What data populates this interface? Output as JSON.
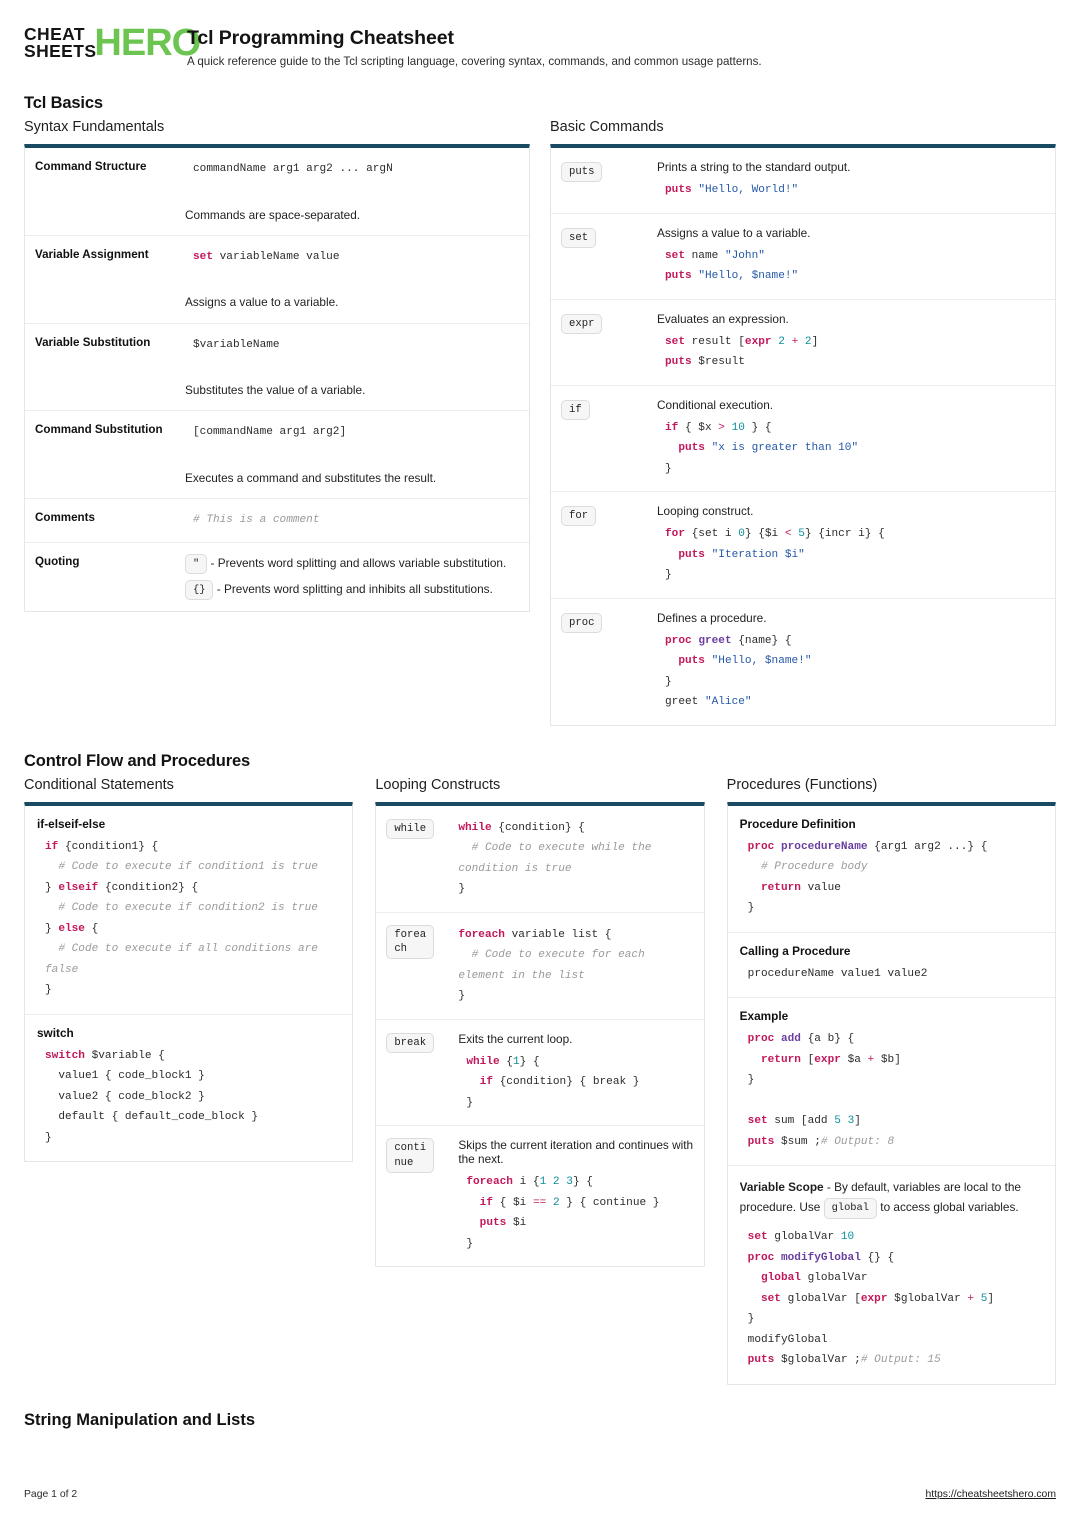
{
  "brand": {
    "line1": "CHEAT",
    "line2": "SHEETS",
    "hero": "HERO",
    "green": "#6cc551"
  },
  "header": {
    "title": "Tcl Programming Cheatsheet",
    "subtitle": "A quick reference guide to the Tcl scripting language, covering syntax, commands, and common usage patterns."
  },
  "sections": {
    "basics": "Tcl Basics",
    "control": "Control Flow and Procedures",
    "strings": "String Manipulation and Lists"
  },
  "syntax": {
    "heading": "Syntax Fundamentals",
    "rows": [
      {
        "label": "Command Structure",
        "code": "commandName arg1 arg2 ... argN",
        "desc": "Commands are space-separated."
      },
      {
        "label": "Variable Assignment",
        "kw": "set",
        "code_rest": " variableName value",
        "desc": "Assigns a value to a variable."
      },
      {
        "label": "Variable Substitution",
        "code": "$variableName",
        "desc": "Substitutes the value of a variable."
      },
      {
        "label": "Command Substitution",
        "code": "[commandName arg1 arg2]",
        "desc": "Executes a command and substitutes the result."
      },
      {
        "label": "Comments",
        "comment": "# This is a comment"
      },
      {
        "label": "Quoting",
        "quote_chip_1": "\"",
        "quote_text_1": "- Prevents word splitting and allows variable substitution.",
        "quote_chip_2": "{}",
        "quote_text_2": "- Prevents word splitting and inhibits all substitutions."
      }
    ]
  },
  "commands": {
    "heading": "Basic Commands",
    "items": [
      {
        "badge": "puts",
        "desc": "Prints a string to the standard output."
      },
      {
        "badge": "set",
        "desc": "Assigns a value to a variable."
      },
      {
        "badge": "expr",
        "desc": "Evaluates an expression."
      },
      {
        "badge": "if",
        "desc": "Conditional execution."
      },
      {
        "badge": "for",
        "desc": "Looping construct."
      },
      {
        "badge": "proc",
        "desc": "Defines a procedure."
      }
    ]
  },
  "conditional": {
    "heading": "Conditional Statements",
    "block1_title": "if-elseif-else",
    "block2_title": "switch"
  },
  "looping": {
    "heading": "Looping Constructs",
    "items": [
      {
        "badge": "while",
        "desc": ""
      },
      {
        "badge": "foreach",
        "desc": ""
      },
      {
        "badge": "break",
        "desc": "Exits the current loop."
      },
      {
        "badge": "continue",
        "desc": "Skips the current iteration and continues with the next."
      }
    ]
  },
  "procedures": {
    "heading": "Procedures (Functions)",
    "def_title": "Procedure Definition",
    "call_title": "Calling a Procedure",
    "call_code": "procedureName value1 value2",
    "example_title": "Example",
    "scope_label": "Variable Scope",
    "scope_text_1": "- By default, variables are local to the procedure. Use",
    "scope_chip": "global",
    "scope_text_2": "to access global variables."
  },
  "footer": {
    "page": "Page 1 of 2",
    "url": "https://cheatsheetshero.com"
  }
}
